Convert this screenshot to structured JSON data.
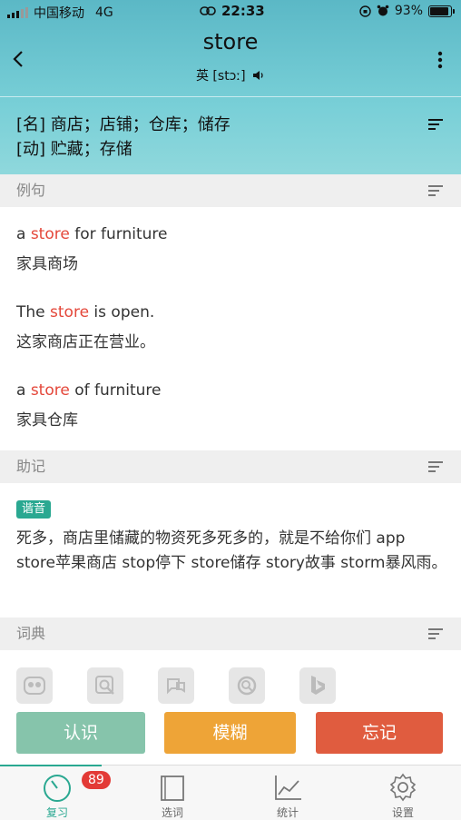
{
  "status": {
    "carrier": "中国移动",
    "network": "4G",
    "time": "22:33",
    "battery": "93%",
    "battery_level": 0.93
  },
  "header": {
    "word": "store",
    "phonetic": "英 [stɔː]",
    "definitions": [
      "[名] 商店；店铺；仓库；储存",
      "[动] 贮藏；存储"
    ]
  },
  "sections": {
    "examples_title": "例句",
    "mnemonic_title": "助记",
    "dict_title": "词典"
  },
  "examples": [
    {
      "pre": "a ",
      "hl": "store",
      "post": " for furniture",
      "zh": "家具商场"
    },
    {
      "pre": "The ",
      "hl": "store",
      "post": " is open.",
      "zh": "这家商店正在营业。"
    },
    {
      "pre": "a ",
      "hl": "store",
      "post": " of furniture",
      "zh": "家具仓库"
    }
  ],
  "mnemonic": {
    "tag": "谐音",
    "text": "死多，商店里储藏的物资死多死多的，就是不给你们 app store苹果商店 stop停下 store储存 story故事 storm暴风雨。"
  },
  "buttons": {
    "know": "认识",
    "vague": "模糊",
    "forget": "忘记"
  },
  "tabs": {
    "review": "复习",
    "review_badge": "89",
    "select": "选词",
    "stats": "统计",
    "settings": "设置"
  }
}
